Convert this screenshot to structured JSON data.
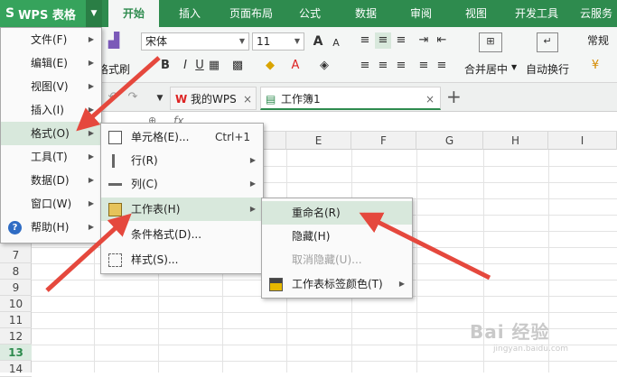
{
  "app": {
    "name": "WPS 表格"
  },
  "ribbon_tabs": [
    "开始",
    "插入",
    "页面布局",
    "公式",
    "数据",
    "审阅",
    "视图",
    "开发工具",
    "云服务"
  ],
  "active_tab": "开始",
  "toolbar": {
    "font_name": "宋体",
    "font_size": "11",
    "brush_label": "格式刷",
    "merge_label": "合并居中",
    "wrap_label": "自动换行",
    "number_format": "常规",
    "font_grow": "A",
    "font_shrink": "A",
    "bold": "B",
    "italic": "I",
    "underline": "U"
  },
  "doc_tabs": [
    {
      "label": "我的WPS"
    },
    {
      "label": "工作簿1"
    }
  ],
  "formula_bar": {
    "fx": "fx"
  },
  "columns": [
    "E",
    "F",
    "G",
    "H",
    "I"
  ],
  "rows": [
    "7",
    "8",
    "9",
    "10",
    "11",
    "12",
    "13",
    "14"
  ],
  "selected_row": "13",
  "main_menu": {
    "items": [
      {
        "label": "文件(F)"
      },
      {
        "label": "编辑(E)"
      },
      {
        "label": "视图(V)"
      },
      {
        "label": "插入(I)"
      },
      {
        "label": "格式(O)"
      },
      {
        "label": "工具(T)"
      },
      {
        "label": "数据(D)"
      },
      {
        "label": "窗口(W)"
      },
      {
        "label": "帮助(H)"
      }
    ],
    "highlighted": "格式(O)"
  },
  "format_menu": {
    "items": [
      {
        "label": "单元格(E)...",
        "shortcut": "Ctrl+1"
      },
      {
        "label": "行(R)"
      },
      {
        "label": "列(C)"
      },
      {
        "label": "工作表(H)"
      },
      {
        "label": "条件格式(D)..."
      },
      {
        "label": "样式(S)..."
      }
    ],
    "highlighted": "工作表(H)"
  },
  "sheet_menu": {
    "items": [
      {
        "label": "重命名(R)"
      },
      {
        "label": "隐藏(H)"
      },
      {
        "label": "取消隐藏(U)...",
        "disabled": true
      },
      {
        "label": "工作表标签颜色(T)"
      }
    ],
    "highlighted": "重命名(R)"
  },
  "colors": {
    "accent": "#2e8b4e",
    "arrow": "#e5483d",
    "highlight": "#d8e8dc"
  },
  "watermark": "Bai 经验",
  "watermark_url": "jingyan.baidu.com"
}
